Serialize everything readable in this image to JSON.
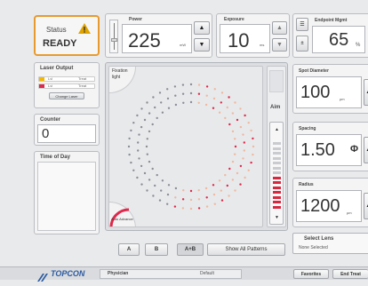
{
  "status": {
    "label": "Status",
    "value": "READY",
    "warning_color": "#e0a400",
    "border_color": "#e89a2e"
  },
  "laser_output": {
    "title": "Laser Output",
    "rows": [
      {
        "left": "Lvl",
        "right": "Treat",
        "color": "#f5b800"
      },
      {
        "left": "Lvl",
        "right": "Treat",
        "color": "#e0284a"
      }
    ],
    "button": "Change Laser"
  },
  "counter": {
    "label": "Counter",
    "value": "0"
  },
  "time_of_day": {
    "label": "Time of Day"
  },
  "power": {
    "label": "Power",
    "value": "225",
    "unit": "mW"
  },
  "exposure": {
    "label": "Exposure",
    "value": "10",
    "unit": "ms"
  },
  "endpoint": {
    "label": "Endpoint Mgmt",
    "value": "65",
    "unit": "%"
  },
  "pattern": {
    "label_line1": "Fixation",
    "label_line2": "light",
    "aim_label": "Aim",
    "bottom_left_label": "Auto Advance",
    "spot_colors": [
      "#8a8f96",
      "#e0284a",
      "#f0b8a0"
    ]
  },
  "spot_diameter": {
    "label": "Spot Diameter",
    "value": "100",
    "unit": "µm"
  },
  "spacing": {
    "label": "Spacing",
    "value": "1.50",
    "unit": "Φ"
  },
  "radius": {
    "label": "Radius",
    "value": "1200",
    "unit": "µm"
  },
  "select_lens": {
    "label": "Select Lens",
    "value": "None Selected"
  },
  "pattern_buttons": [
    "A",
    "B",
    "A+B",
    "Show All Patterns"
  ],
  "footer": {
    "logo": "TOPCON",
    "physician": "Physician",
    "default": "Default",
    "favorites": "Favorites",
    "end_treatment": "End Treat"
  }
}
